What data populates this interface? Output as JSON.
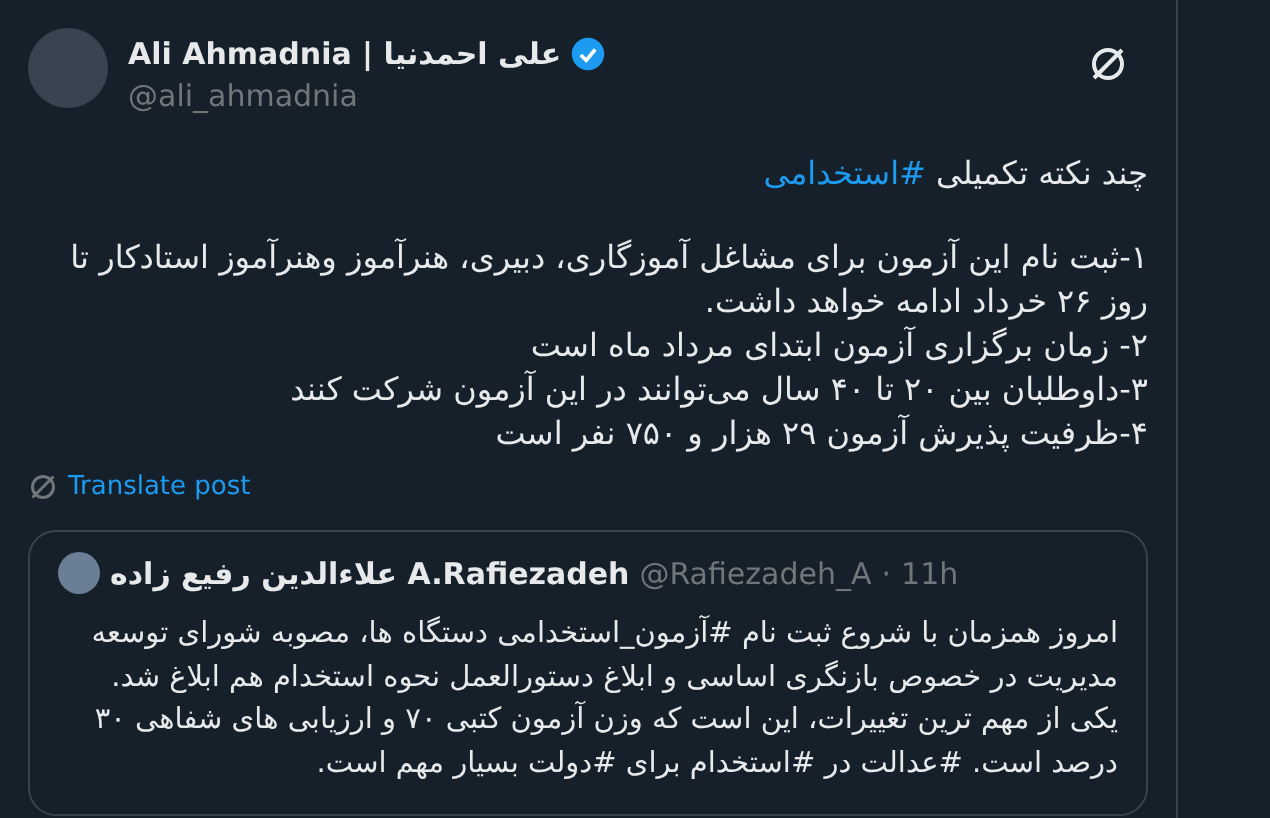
{
  "author": {
    "name": "Ali Ahmadnia | علی احمدنیا",
    "verified": true,
    "handle": "@ali_ahmadnia"
  },
  "intro": {
    "text": "چند نکته تکمیلی",
    "hashtag": "#استخدامی"
  },
  "body": [
    "۱-ثبت نام این آزمون برای مشاغل آموزگاری، دبیری، هنرآموز وهنرآموز استادکار تا روز ۲۶ خرداد ادامه خواهد داشت.",
    "۲- زمان برگزاری آزمون ابتدای مرداد ماه است",
    "۳-داوطلبان بین ۲۰ تا ۴۰ سال می‌توانند در این آزمون شرکت کنند",
    "۴-ظرفیت پذیرش آزمون ۲۹ هزار و ۷۵۰ نفر است"
  ],
  "translate": "Translate post",
  "quote": {
    "name": "علاءالدین رفیع زاده A.Rafiezadeh",
    "handle": "@Rafiezadeh_A",
    "separator": "·",
    "time": "11h",
    "text": "امروز همزمان با شروع ثبت نام #آزمون_استخدامی دستگاه ها، مصوبه شورای توسعه مدیریت در خصوص بازنگری اساسی و ابلاغ دستورالعمل نحوه استخدام هم ابلاغ شد. یکی از مهم ترین تغییرات، این است که وزن آزمون کتبی ۷۰ و  ارزیابی های شفاهی ۳۰ درصد است. #عدالت در #استخدام برای #دولت بسیار مهم است."
  }
}
